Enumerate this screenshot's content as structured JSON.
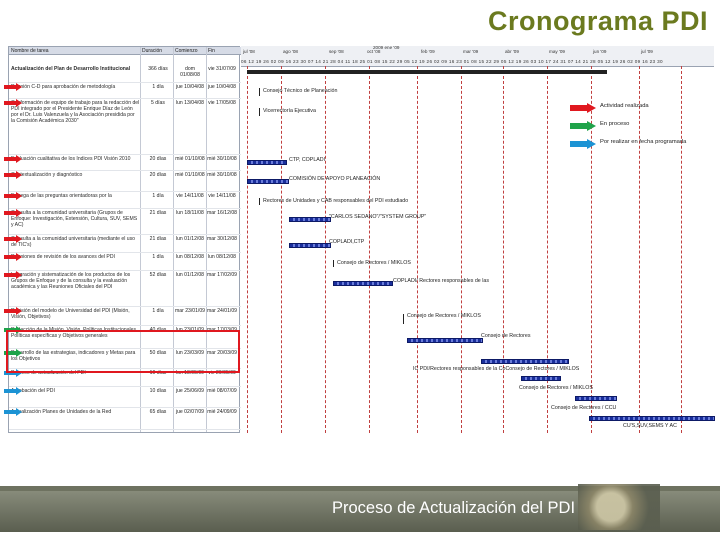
{
  "title": "Cronograma PDI",
  "footer": "Proceso de Actualización del PDI",
  "columns": {
    "name": "Nombre de tarea",
    "duration": "Duración",
    "start": "Comienzo",
    "end": "Fin"
  },
  "timeline_header": {
    "weeks": [
      "jul '08",
      "ago '08",
      "sep '08",
      "oct '08",
      "2009 ene '09",
      "feb '09",
      "mar '09",
      "abr '09",
      "may '09",
      "jun '09",
      "jul '09"
    ],
    "days": "06 12 19 26 02 09 16 23 30 07 14 21 28 04 11 18 25 01 08 15 22 29 05 12 19 26 02 09 16 23 01 08 15 22 29 05 12 19 26 03 10 17 24 31 07 14 21 28 05 12 19 26 02 09 16 23 30"
  },
  "rows": [
    {
      "name": "Actualización del Plan de Desarrollo Institucional",
      "dur": "366 días",
      "start": "dom 01/08/08",
      "end": "vie 31/07/09",
      "arrow": ""
    },
    {
      "name": "Reunión C-D para aprobación de metodología",
      "dur": "1 día",
      "start": "jue 10/04/08",
      "end": "jue 10/04/08",
      "arrow": "red"
    },
    {
      "name": "Conformación de equipo de trabajo para la redacción del PDI integrado por el Presidente Enrique Díaz de León por el Dr. Luis Valenzuela y la Asociación presidida por la Comisión Académica 2030\"",
      "dur": "5 días",
      "start": "lun 13/04/08",
      "end": "vie 17/05/08",
      "arrow": "red"
    },
    {
      "name": "Evaluación cualitativa de los Índices PDI Visión 2010",
      "dur": "20 días",
      "start": "mié 01/10/08",
      "end": "mié 30/10/08",
      "arrow": "red"
    },
    {
      "name": "Contextualización y diagnóstico",
      "dur": "20 días",
      "start": "mié 01/10/08",
      "end": "mié 30/10/08",
      "arrow": "red"
    },
    {
      "name": "Entrega de las preguntas orientadoras por la",
      "dur": "1 día",
      "start": "vie 14/11/08",
      "end": "vie 14/11/08",
      "arrow": "red"
    },
    {
      "name": "Consulta a la comunidad universitaria (Grupos de Enfoque: Investigación, Extensión, Cultura, SUV, SEMS y AC)",
      "dur": "21 días",
      "start": "lun 18/11/08",
      "end": "mar 16/12/08",
      "arrow": "red"
    },
    {
      "name": "Consulta a la comunidad universitaria (mediante el uso de TIC's)",
      "dur": "21 días",
      "start": "lun 01/12/08",
      "end": "mar 30/12/08",
      "arrow": "red"
    },
    {
      "name": "Reuniones de revisión de los avances del PDI",
      "dur": "1 día",
      "start": "lun 08/12/08",
      "end": "lun 08/12/08",
      "arrow": "red"
    },
    {
      "name": "Integración y sistematización de los productos de los Grupos de Enfoque y de la consulta y la evaluación académica y las Reuniones Oficiales del PDI",
      "dur": "52 días",
      "start": "lun 01/12/08",
      "end": "mar 17/02/09",
      "arrow": "red"
    },
    {
      "name": "Revisión del modelo de Universidad del PDI (Misión, Visión, Objetivos)",
      "dur": "1 día",
      "start": "mar 23/01/09",
      "end": "mar 24/01/09",
      "arrow": "red"
    },
    {
      "name": "Redacción de la Misión, Visión, Políticas Institucionales, Políticas específicas y Objetivos generales",
      "dur": "40 días",
      "start": "lun 23/01/09",
      "end": "mar 17/03/09",
      "arrow": "green"
    },
    {
      "name": "Desarrollo de las estrategias, indicadores y Metas para los Objetivos",
      "dur": "50 días",
      "start": "lun 23/03/09",
      "end": "mar 20/03/09",
      "arrow": "green"
    },
    {
      "name": "Proceso de actualización del PDI",
      "dur": "10 días",
      "start": "lun 18/05/09",
      "end": "vie 29/05/09",
      "arrow": "blue"
    },
    {
      "name": "Aprobación del PDI",
      "dur": "10 días",
      "start": "jue 25/06/09",
      "end": "mié 08/07/09",
      "arrow": "blue"
    },
    {
      "name": "Actualización Planes de Unidades de la Red",
      "dur": "65 días",
      "start": "jue 02/07/09",
      "end": "mié 24/09/09",
      "arrow": "blue"
    }
  ],
  "gantt_labels": {
    "consejo_tecnico": "Consejo Técnico de Planeación",
    "vicerrectoria": "Vicerrectoría Ejecutiva",
    "ctp_copladi": "CTP, COPLADI",
    "comision": "COMISIÓN DE APOYO PLANEACIÓN",
    "rectores": "Rectores de Unidades y CAB responsables del PDI estudiado",
    "carlos": "\"CARLOS SEDANO\"/\"SYSTEM GROUP\"",
    "copladi_ctp": "COPLADI,CTP",
    "consejo_rectores_1": "Consejo de Rectores / MIKLOS",
    "copladi_rectores": "COPLADI/ Rectores responsables de las",
    "consejo_rectores_2": "Consejo de Rectores / MIKLOS",
    "consejo_rectores_3": "Consejo de Rectores",
    "integrado": "IC PDI/Rectores responsables de la CoConsejo de Rectores / MIKLOS",
    "consejo_mikl": "Consejo de Rectores / MIKLOS",
    "consejo_ccu": "Consejo de Rectores / CCU",
    "cu_final": "CU'S,SUV,SEMS Y AC"
  },
  "legend": [
    {
      "label": "Actividad realizada",
      "color": "#e0181f"
    },
    {
      "label": "En proceso",
      "color": "#1fa34a"
    },
    {
      "label": "Por realizar en fecha programada",
      "color": "#1c93d4"
    }
  ]
}
